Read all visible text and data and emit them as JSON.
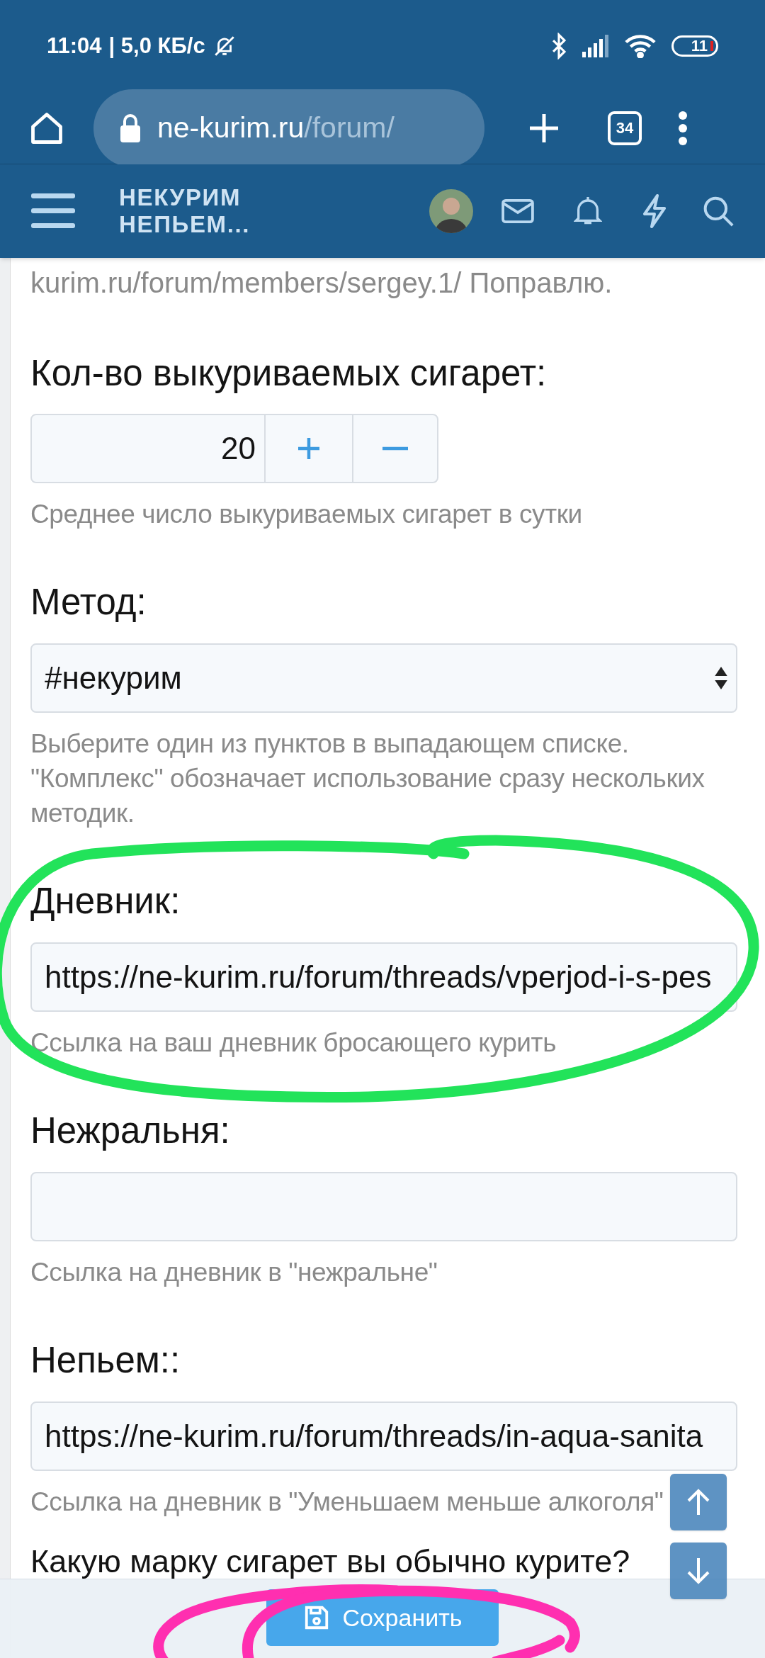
{
  "status_bar": {
    "time": "11:04",
    "speed": "| 5,0 КБ/с",
    "battery": "11"
  },
  "browser": {
    "url_host": "ne-kurim.ru",
    "url_path": "/forum/",
    "tabs_count": "34"
  },
  "forum_header": {
    "logo_lines": [
      "НЕКУРИМ",
      "НЕПЬЕМ..."
    ]
  },
  "form": {
    "intro_text": "kurim.ru/forum/members/sergey.1/ Поправлю.",
    "fields": [
      {
        "kind": "spinner",
        "label": "Кол-во выкуриваемых сигарет:",
        "value": "20",
        "hint": "Среднее число выкуриваемых сигарет в сутки"
      },
      {
        "kind": "select",
        "label": "Метод:",
        "value": "#некурим",
        "hint": "Выберите один из пунктов в выпадающем списке. \"Комплекс\" обозначает использование сразу нескольких методик."
      },
      {
        "kind": "input",
        "label": "Дневник:",
        "value": "https://ne-kurim.ru/forum/threads/vperjod-i-s-pes",
        "hint": "Ссылка на ваш дневник бросающего курить"
      },
      {
        "kind": "input",
        "label": "Нежральня:",
        "hint": "Ссылка на дневник в \"нежральне\""
      },
      {
        "kind": "input",
        "label": "Непьем::",
        "value": "https://ne-kurim.ru/forum/threads/in-aqua-sanita",
        "hint": "Ссылка на дневник в \"Уменьшаем меньше алкоголя\""
      },
      {
        "kind": "heading",
        "label": "Какую марку сигарет вы обычно курите?"
      }
    ]
  },
  "save_button": "Сохранить",
  "annotations": [
    {
      "color": "#22e35a"
    },
    {
      "color": "#ff2fb0"
    }
  ]
}
